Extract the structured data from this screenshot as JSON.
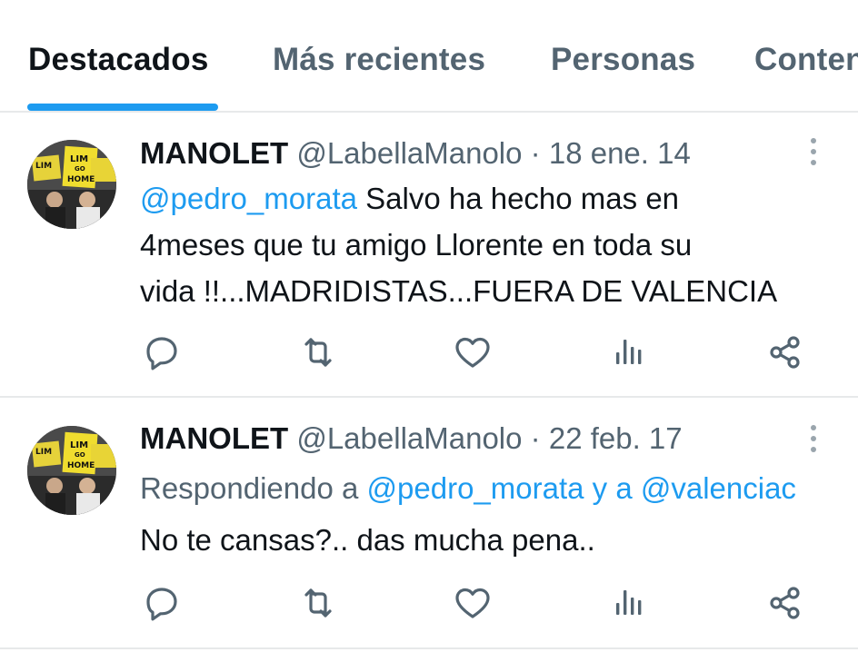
{
  "tabs": [
    {
      "label": "Destacados",
      "active": true
    },
    {
      "label": "Más recientes",
      "active": false
    },
    {
      "label": "Personas",
      "active": false
    },
    {
      "label": "Conten",
      "active": false
    }
  ],
  "colors": {
    "accent": "#1d9bf0",
    "text": "#0f1419",
    "secondary": "#536471",
    "divider": "#e7e9ea"
  },
  "tweets": [
    {
      "name": "MANOLET",
      "handle": "@LabellaManolo",
      "separator": "·",
      "date": "18 ene. 14",
      "avatar_sign_text": [
        "LIM",
        "GO",
        "HOME"
      ],
      "lines": [
        {
          "mention": "@pedro_morata",
          "text": " Salvo ha hecho mas en"
        },
        {
          "text": "4meses que tu amigo Llorente en toda su"
        },
        {
          "text": "vida !!...MADRIDISTAS...FUERA DE VALENCIA"
        }
      ],
      "actions": [
        "reply-icon",
        "retweet-icon",
        "like-icon",
        "views-icon",
        "share-icon"
      ]
    },
    {
      "name": "MANOLET",
      "handle": "@LabellaManolo",
      "separator": "·",
      "date": "22 feb. 17",
      "avatar_sign_text": [
        "LIM",
        "GO",
        "HOME"
      ],
      "replying_prefix": "Respondiendo a ",
      "replying_mention_1": "@pedro_morata",
      "replying_join": " y a ",
      "replying_mention_2": "@valenciac",
      "lines": [
        {
          "text": "No te cansas?.. das mucha pena.."
        }
      ],
      "actions": [
        "reply-icon",
        "retweet-icon",
        "like-icon",
        "views-icon",
        "share-icon"
      ]
    }
  ]
}
